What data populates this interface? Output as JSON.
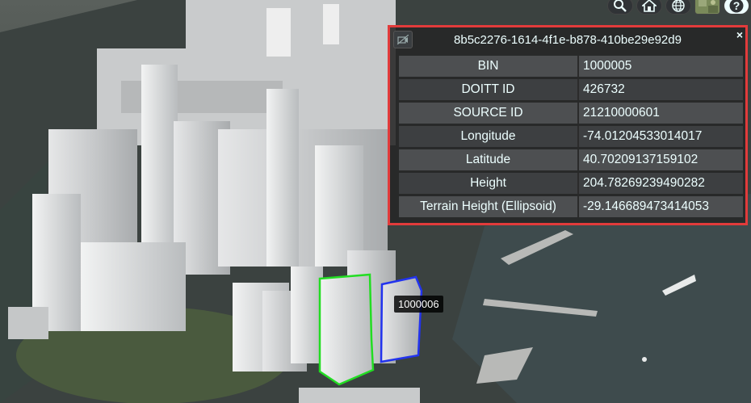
{
  "toolbar": {
    "buttons": [
      {
        "name": "search-icon"
      },
      {
        "name": "home-icon"
      },
      {
        "name": "globe-icon"
      },
      {
        "name": "imagery-picker-icon"
      },
      {
        "name": "help-icon"
      }
    ]
  },
  "hover_label": "1000006",
  "infobox": {
    "title": "8b5c2276-1614-4f1e-b878-410be29e92d9",
    "close": "×",
    "rows": [
      {
        "key": "BIN",
        "value": "1000005"
      },
      {
        "key": "DOITT ID",
        "value": "426732"
      },
      {
        "key": "SOURCE ID",
        "value": "21210000601"
      },
      {
        "key": "Longitude",
        "value": "-74.01204533014017"
      },
      {
        "key": "Latitude",
        "value": "40.70209137159102"
      },
      {
        "key": "Height",
        "value": "204.78269239490282"
      },
      {
        "key": "Terrain Height (Ellipsoid)",
        "value": "-29.146689473414053"
      }
    ]
  },
  "colors": {
    "selection_highlight": "#e23b3b",
    "selected_building_outline": "#22dd22",
    "hovered_building_outline": "#2233ee",
    "water": "#3d4a4c",
    "buildings": "#d9dbdc"
  }
}
